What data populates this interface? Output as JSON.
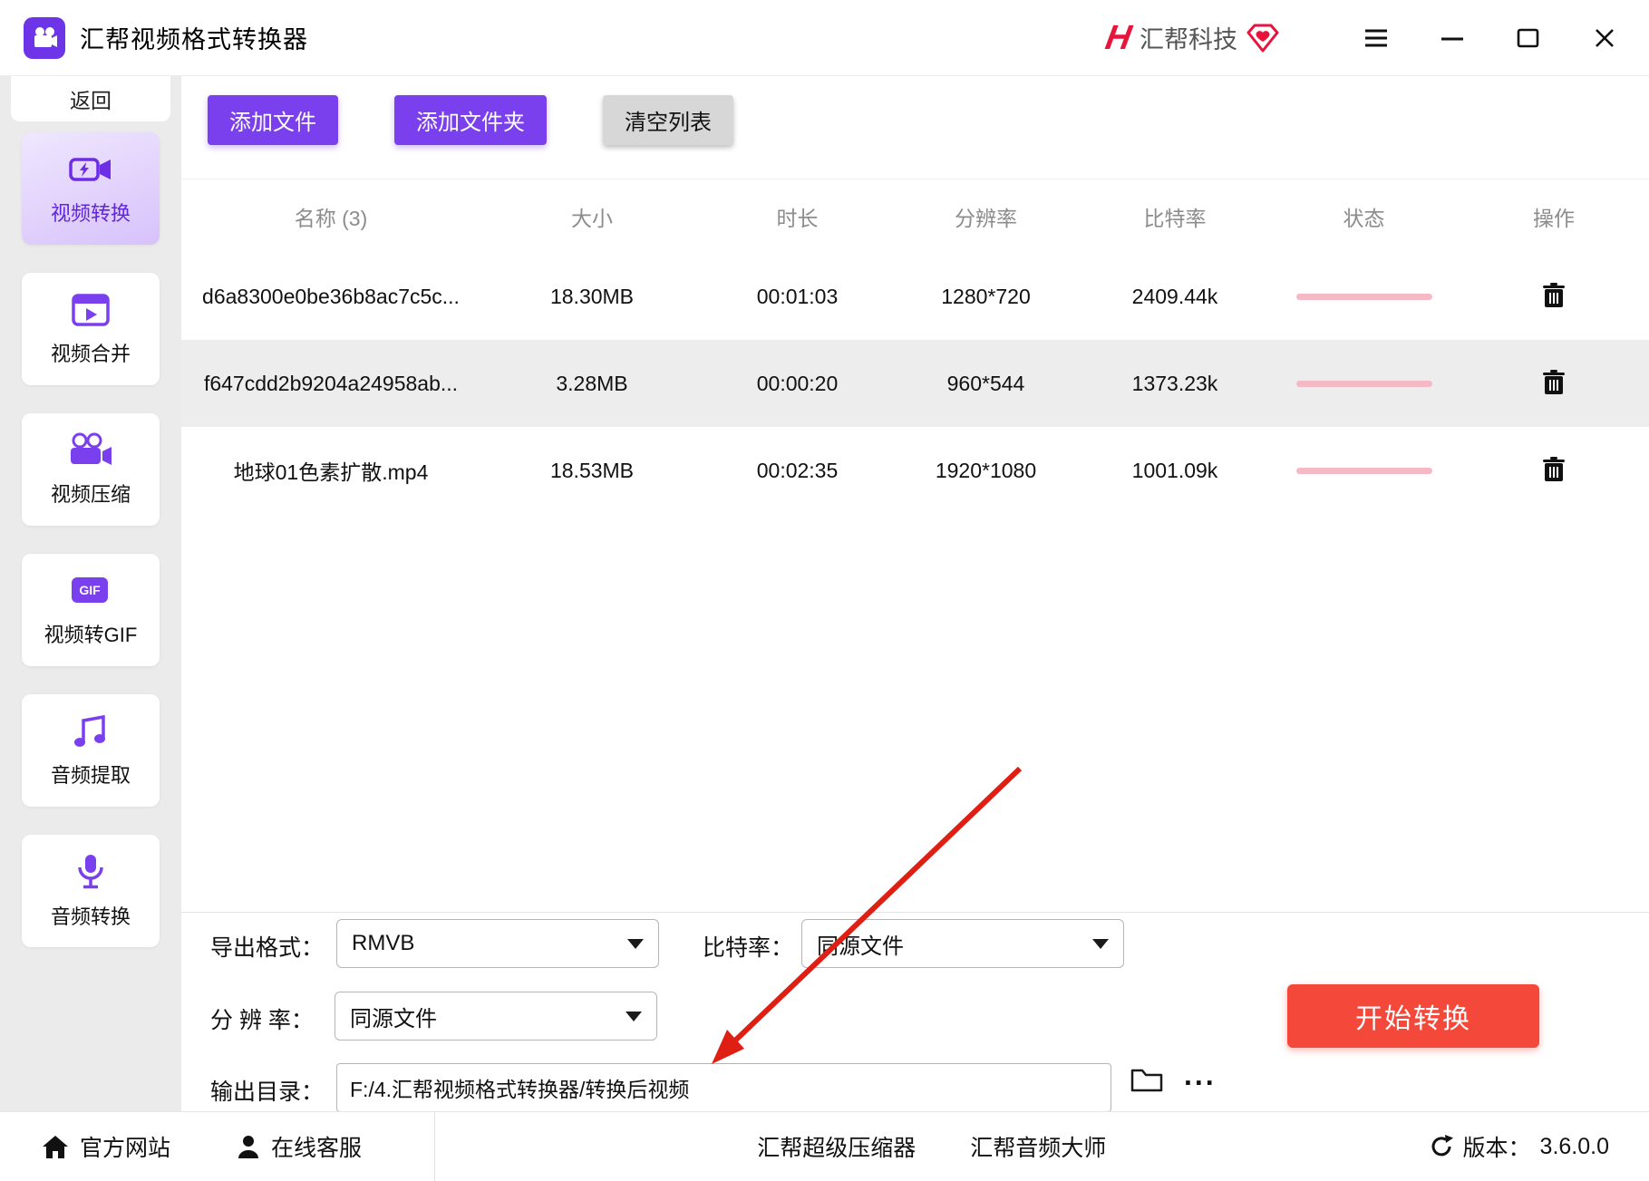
{
  "window": {
    "title": "汇帮视频格式转换器",
    "brand_text": "汇帮科技"
  },
  "sidebar": {
    "back": "返回",
    "gif_icon_text": "GIF",
    "items": [
      {
        "label": "视频转换",
        "active": true
      },
      {
        "label": "视频合并",
        "active": false
      },
      {
        "label": "视频压缩",
        "active": false
      },
      {
        "label": "视频转GIF",
        "active": false
      },
      {
        "label": "音频提取",
        "active": false
      },
      {
        "label": "音频转换",
        "active": false
      }
    ]
  },
  "toolbar": {
    "add_file": "添加文件",
    "add_folder": "添加文件夹",
    "clear_list": "清空列表"
  },
  "table": {
    "headers": {
      "name": "名称 (3)",
      "size": "大小",
      "duration": "时长",
      "resolution": "分辨率",
      "bitrate": "比特率",
      "status": "状态",
      "action": "操作"
    },
    "rows": [
      {
        "name": "d6a8300e0be36b8ac7c5c...",
        "size": "18.30MB",
        "duration": "00:01:03",
        "resolution": "1280*720",
        "bitrate": "2409.44k"
      },
      {
        "name": "f647cdd2b9204a24958ab...",
        "size": "3.28MB",
        "duration": "00:00:20",
        "resolution": "960*544",
        "bitrate": "1373.23k"
      },
      {
        "name": "地球01色素扩散.mp4",
        "size": "18.53MB",
        "duration": "00:02:35",
        "resolution": "1920*1080",
        "bitrate": "1001.09k"
      }
    ]
  },
  "settings": {
    "export_format_label": "导出格式：",
    "export_format_value": "RMVB",
    "bitrate_label": "比特率：",
    "bitrate_value": "同源文件",
    "resolution_label": "分 辨 率：",
    "resolution_value": "同源文件",
    "output_dir_label": "输出目录：",
    "output_dir_value": "F:/4.汇帮视频格式转换器/转换后视频",
    "start_button": "开始转换",
    "more_options": "..."
  },
  "footer": {
    "official_site": "官方网站",
    "online_service": "在线客服",
    "link_compressor": "汇帮超级压缩器",
    "link_audio_master": "汇帮音频大师",
    "version_label": "版本：",
    "version_value": "3.6.0.0"
  },
  "icons": {
    "app": "movie-camera-icon",
    "brand_mark": "lightning-h-logo-icon",
    "brand_badge": "diamond-heart-badge-icon",
    "menu": "hamburger-menu-icon",
    "minimize": "minimize-icon",
    "maximize": "maximize-icon",
    "close": "close-icon",
    "nav": [
      "video-convert-icon",
      "video-merge-icon",
      "video-compress-icon",
      "video-to-gif-icon",
      "audio-extract-icon",
      "audio-convert-icon"
    ],
    "row_action": "trash-icon",
    "dropdown": "chevron-down-icon",
    "output": "folder-icon",
    "footer": [
      "home-icon",
      "person-icon",
      "refresh-icon"
    ],
    "annotation": "red-arrow-pointing-to-output-dir"
  },
  "colors": {
    "accent_purple": "#7b40ee",
    "active_nav_bg": "#d7c2fb",
    "start_red": "#f4483b",
    "progress_pink": "#f5b9c6",
    "arrow_red": "#df1f14",
    "brand_red": "#e8143c",
    "alt_row_gray": "#ededed"
  }
}
